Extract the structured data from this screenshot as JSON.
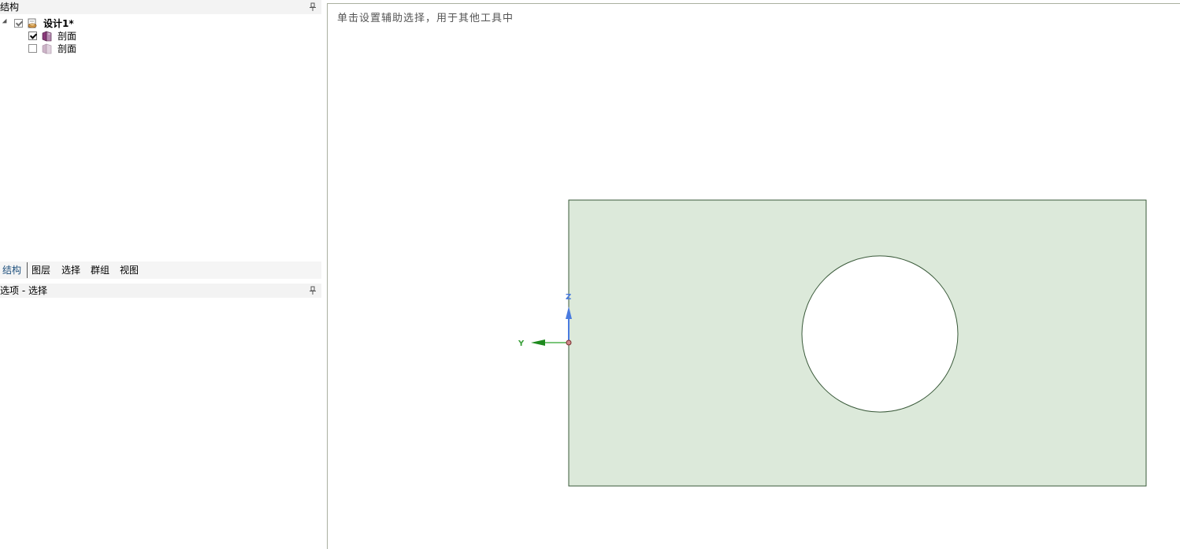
{
  "structure_panel": {
    "title": "结构",
    "tree": {
      "root": {
        "label": "设计1*",
        "checked": true
      },
      "items": [
        {
          "label": "剖面",
          "checked": true
        },
        {
          "label": "剖面",
          "checked": false
        }
      ]
    }
  },
  "tabs": [
    {
      "label": "结构",
      "active": true
    },
    {
      "label": "图层",
      "active": false
    },
    {
      "label": "选择",
      "active": false
    },
    {
      "label": "群组",
      "active": false
    },
    {
      "label": "视图",
      "active": false
    }
  ],
  "options_panel": {
    "title": "选项 - 选择"
  },
  "viewport": {
    "hint": "单击设置辅助选择，用于其他工具中",
    "axes": {
      "z_label": "Z",
      "y_label": "Y"
    },
    "colors": {
      "sketch_fill": "#dce9da",
      "outline": "#3a5a3a",
      "z_axis": "#4a7be0",
      "y_axis": "#3aa03a",
      "origin": "#b06060"
    }
  },
  "icons": {
    "pin": "pin-icon",
    "design": "design-icon",
    "section": "section-icon"
  }
}
